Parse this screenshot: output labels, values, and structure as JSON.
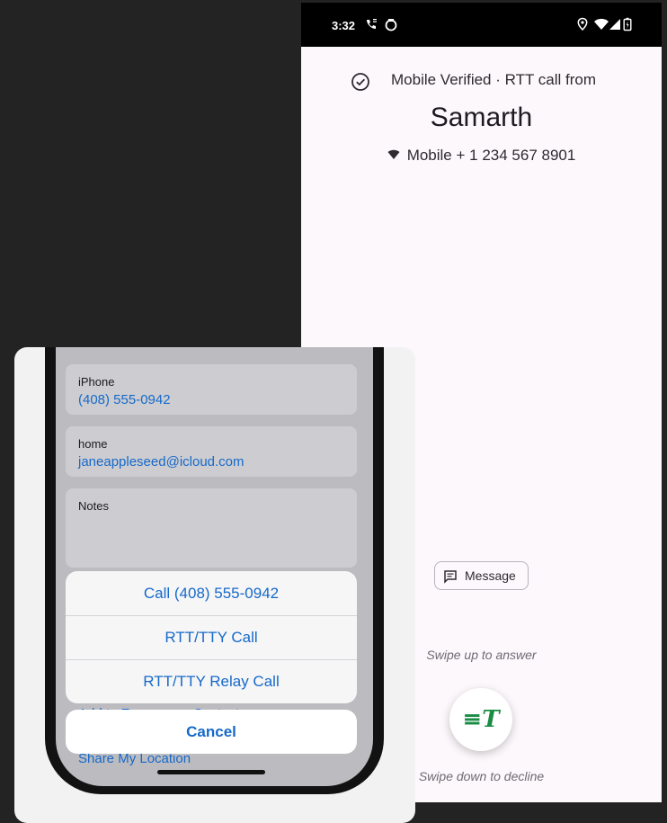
{
  "android": {
    "status_bar": {
      "time": "3:32",
      "icons": [
        "rtt-call-icon",
        "app-indicator-icon",
        "location-icon",
        "wifi-icon",
        "cell-signal-icon",
        "battery-icon"
      ]
    },
    "verified_text": "Mobile Verified  ·  RTT call from",
    "caller_name": "Samarth",
    "number_line": "Mobile  + 1 234 567 8901",
    "message_label": "Message",
    "swipe_up_text": "Swipe up to answer",
    "answer_glyph": "≡T",
    "swipe_down_text": "Swipe down to decline",
    "colors": {
      "background": "#fdf8fc",
      "answer_green": "#1a8c44",
      "status_bar": "#000000"
    }
  },
  "ios": {
    "phone_cell": {
      "label": "iPhone",
      "value": "(408) 555-0942"
    },
    "email_cell": {
      "label": "home",
      "value": "janeappleseed@icloud.com"
    },
    "notes_cell": {
      "label": "Notes"
    },
    "action_sheet": {
      "items": [
        "Call (408) 555-0942",
        "RTT/TTY Call",
        "RTT/TTY Relay Call"
      ],
      "cancel": "Cancel"
    },
    "peek_emergency": "Add to Emergency Contacts",
    "peek_share": "Share My Location",
    "colors": {
      "link_blue": "#1669c9",
      "card_bg": "#f2f2f2"
    }
  }
}
